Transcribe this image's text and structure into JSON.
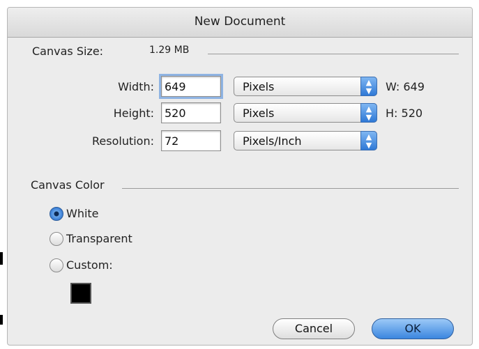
{
  "dialog": {
    "title": "New Document",
    "canvas_size": {
      "label": "Canvas Size:",
      "value": "1.29 MB"
    },
    "fields": [
      {
        "label": "Width:",
        "value": "649",
        "unit": "Pixels",
        "readout": "W: 649"
      },
      {
        "label": "Height:",
        "value": "520",
        "unit": "Pixels",
        "readout": "H: 520"
      },
      {
        "label": "Resolution:",
        "value": "72",
        "unit": "Pixels/Inch",
        "readout": ""
      }
    ],
    "canvas_color": {
      "label": "Canvas Color",
      "options": [
        {
          "label": "White",
          "selected": true
        },
        {
          "label": "Transparent",
          "selected": false
        },
        {
          "label": "Custom:",
          "selected": false
        }
      ],
      "custom_color": "#000000"
    },
    "buttons": {
      "cancel": "Cancel",
      "ok": "OK"
    }
  },
  "colors": {
    "accent": "#3b86df",
    "background": "#ececec"
  }
}
